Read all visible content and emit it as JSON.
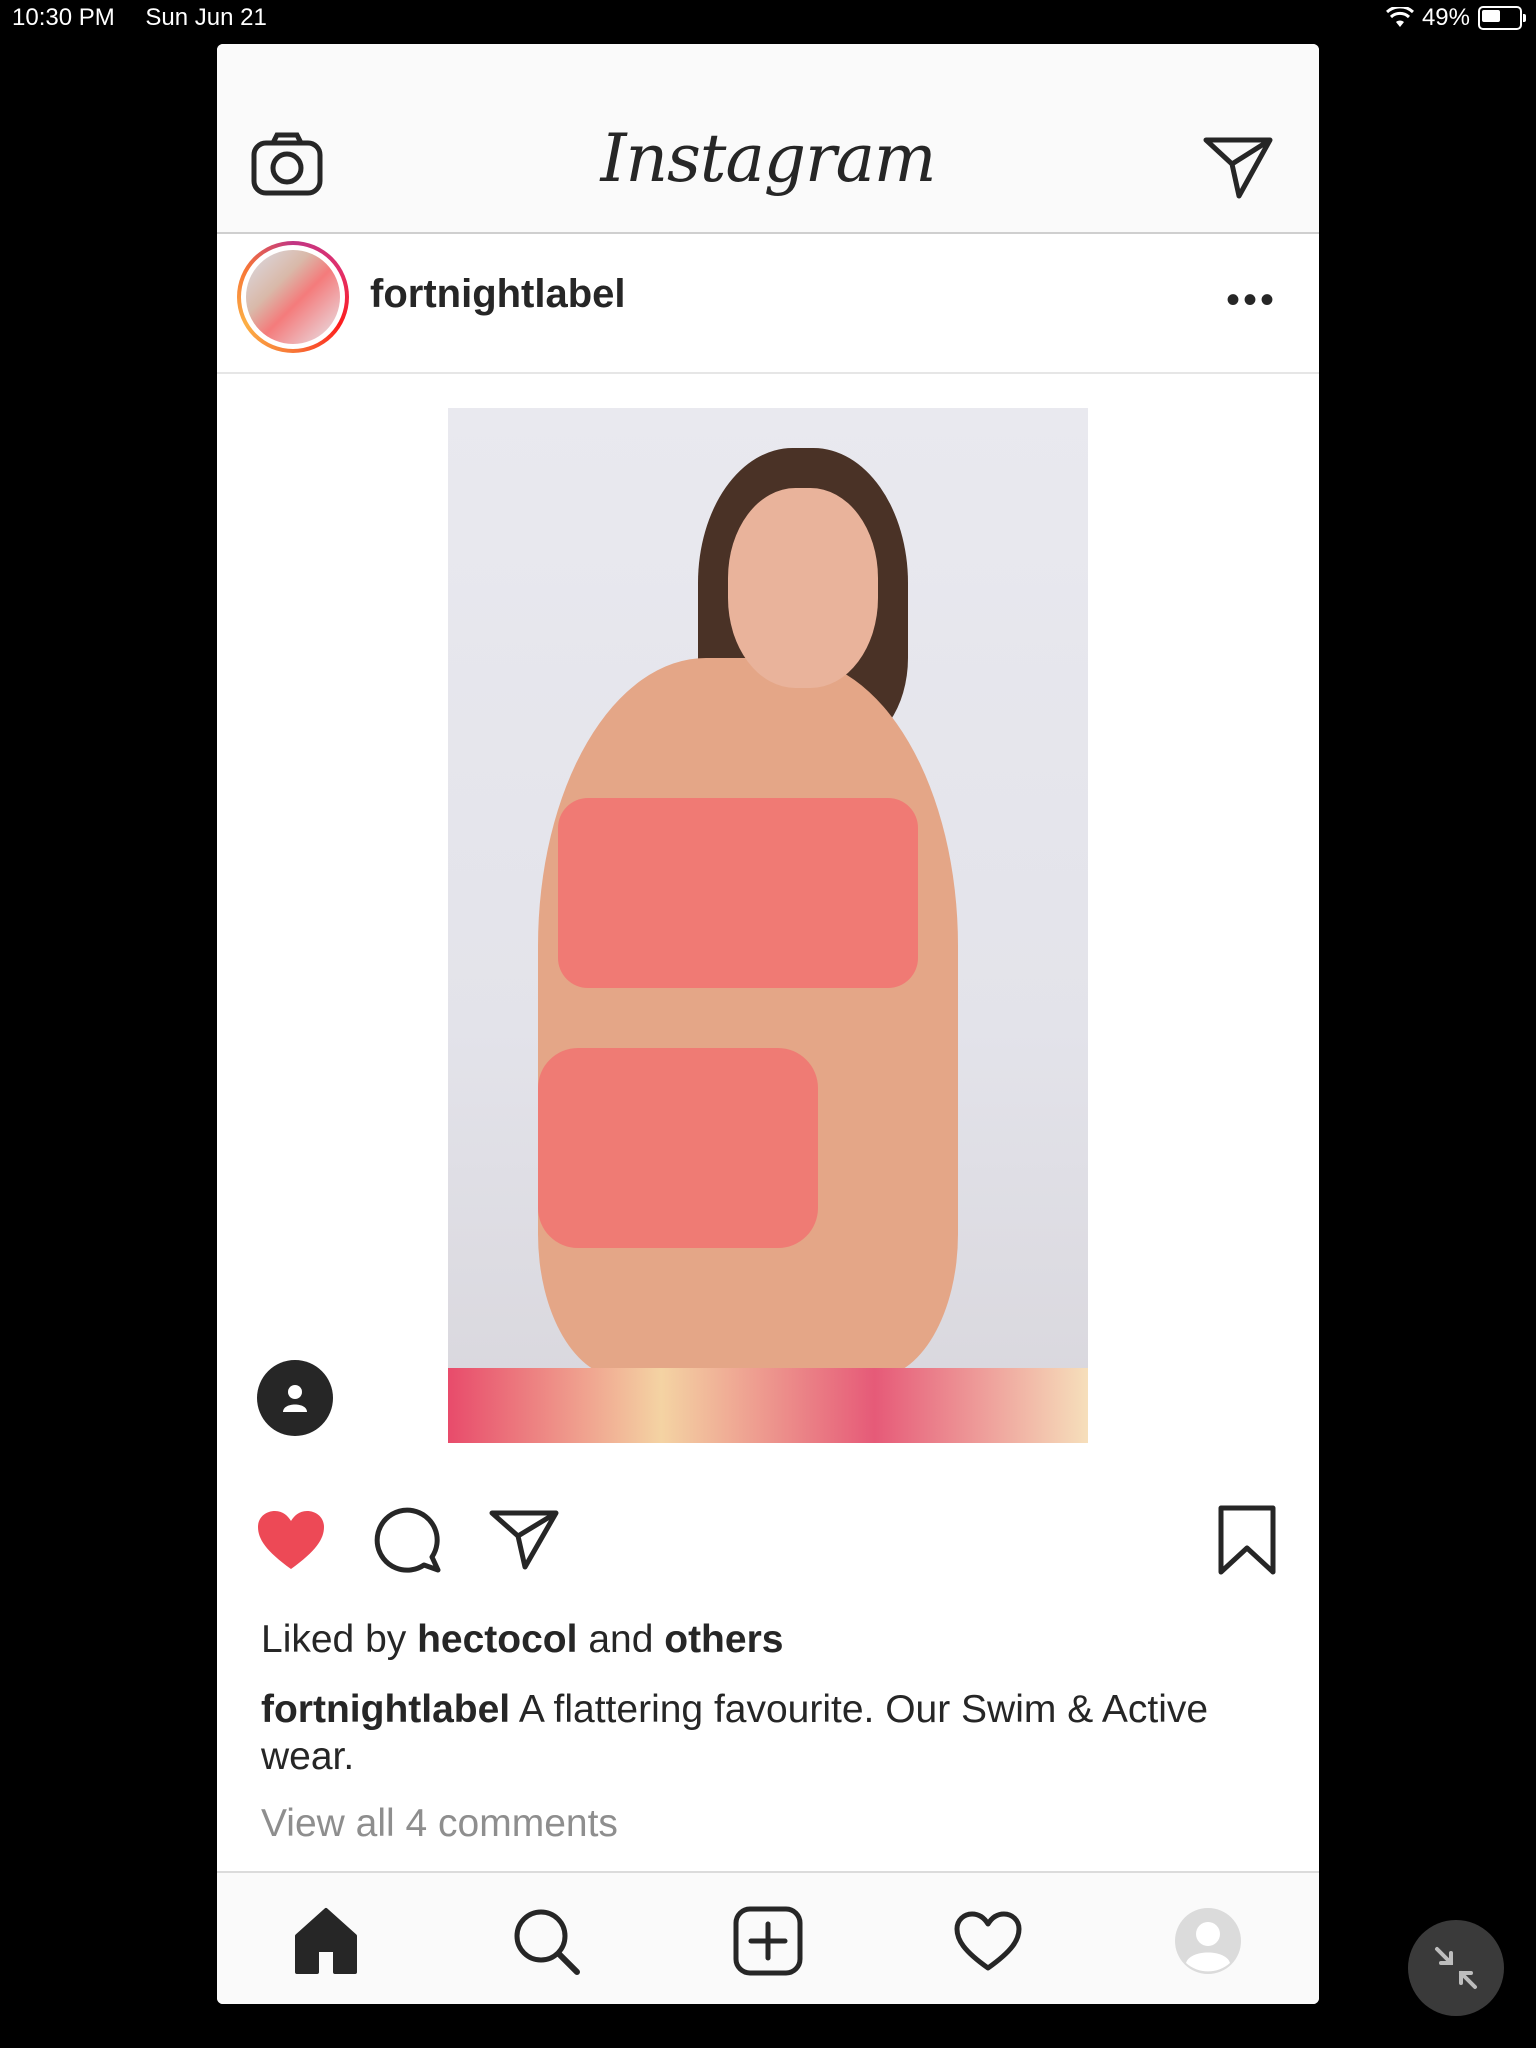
{
  "status": {
    "time": "10:30 PM",
    "date": "Sun Jun 21",
    "battery": "49%",
    "battery_level": 0.49
  },
  "app": {
    "logo": "Instagram"
  },
  "post": {
    "username": "fortnightlabel",
    "more_label": "•••",
    "liked": true,
    "likes": {
      "prefix": "Liked by",
      "user": "hectocol",
      "mid": "and",
      "suffix": "others"
    },
    "caption": {
      "user": "fortnightlabel",
      "text": "A flattering favourite. Our Swim & Active wear."
    },
    "comments_link": "View all 4 comments"
  },
  "icons": {
    "camera": "camera-icon",
    "direct": "paper-plane-icon",
    "like": "heart-filled-icon",
    "comment": "comment-bubble-icon",
    "share": "paper-plane-icon",
    "save": "bookmark-icon",
    "tag": "person-tag-icon",
    "home": "home-icon",
    "search": "search-icon",
    "new_post": "plus-square-icon",
    "activity": "heart-outline-icon",
    "profile": "profile-icon",
    "collapse": "arrows-collapse-icon"
  },
  "colors": {
    "like": "#ed4956",
    "text": "#262626",
    "muted": "#8e8e8e",
    "divider": "#dbdbdb"
  }
}
